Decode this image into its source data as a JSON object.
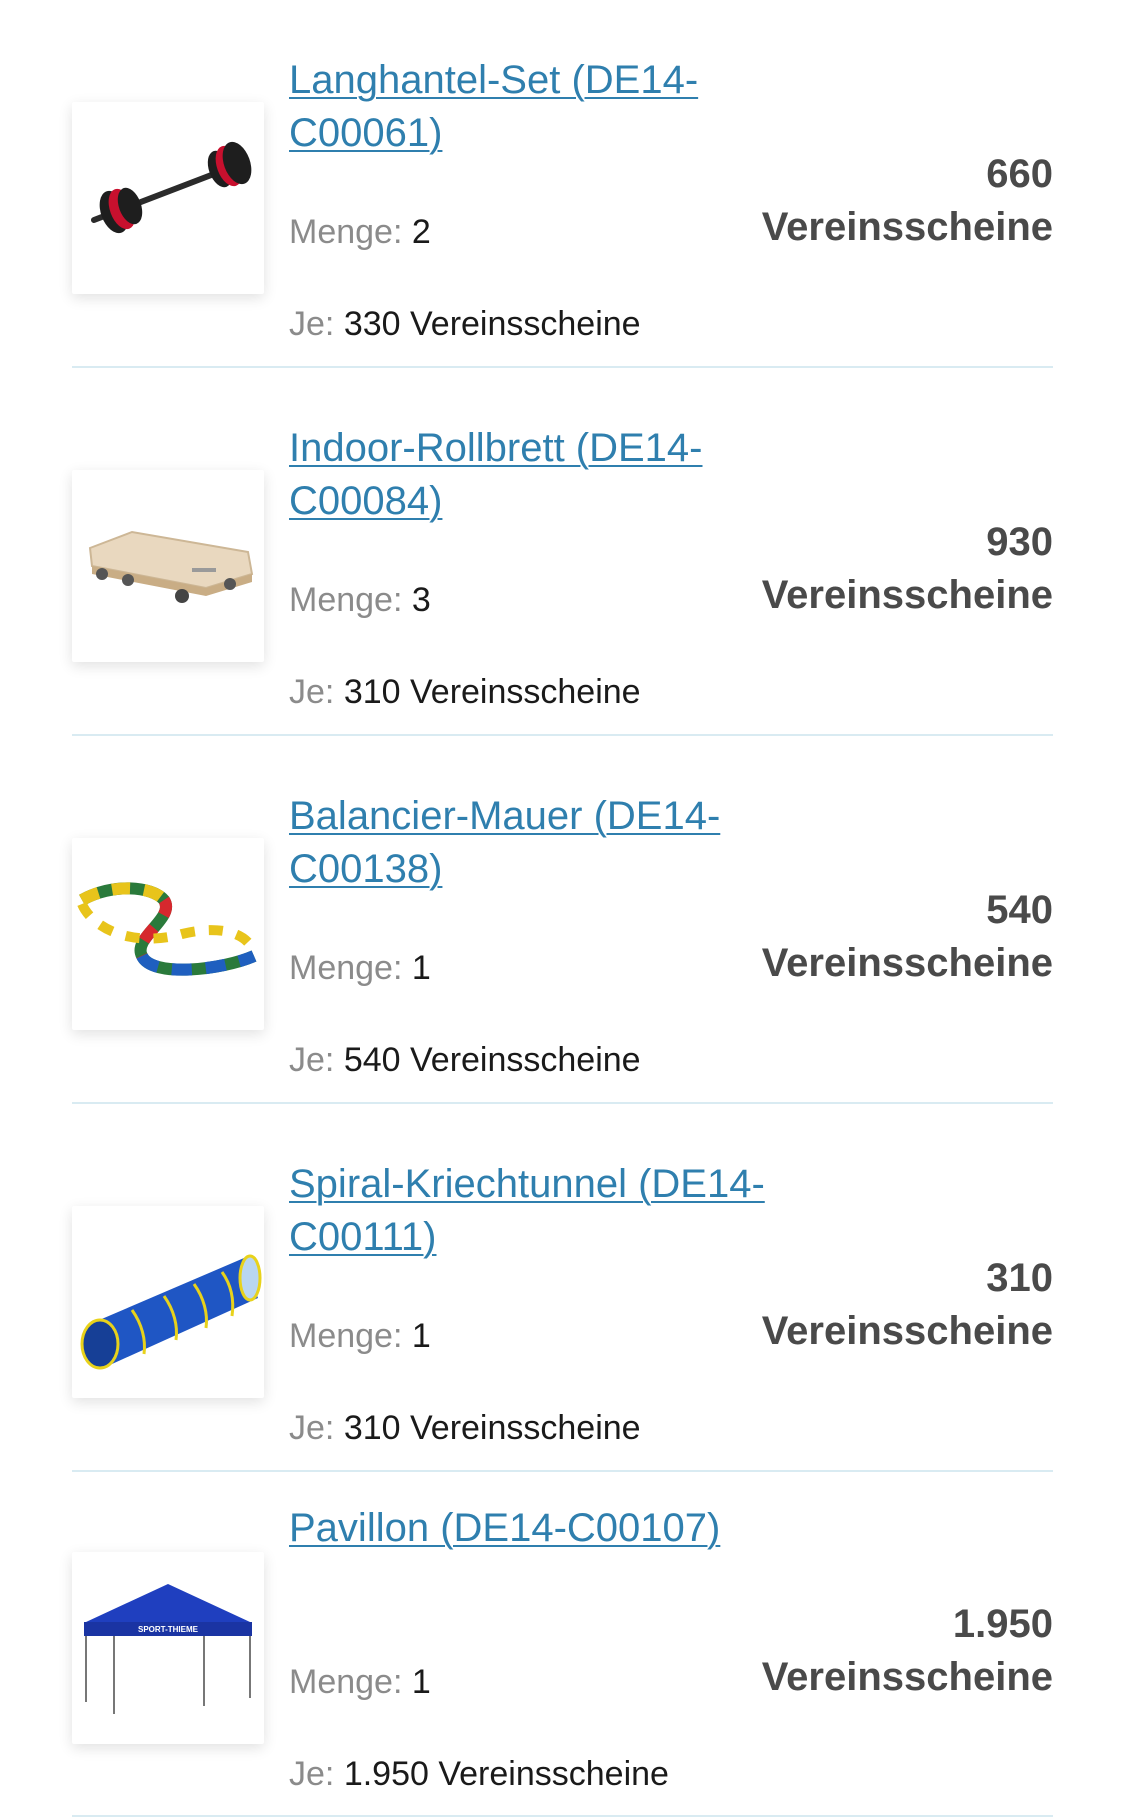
{
  "labels": {
    "quantity": "Menge:",
    "each": "Je:",
    "currency": "Vereinsscheine"
  },
  "items": [
    {
      "title": "Langhantel-Set (DE14-C00061)",
      "quantity": "2",
      "each_price": "330 Vereinsscheine",
      "total_amount": "660",
      "total_unit": "Vereinsscheine",
      "image": "barbell-set-image"
    },
    {
      "title": "Indoor-Rollbrett (DE14-C00084)",
      "quantity": "3",
      "each_price": "310 Vereinsscheine",
      "total_amount": "930",
      "total_unit": "Vereinsscheine",
      "image": "roller-board-image"
    },
    {
      "title": "Balancier-Mauer (DE14-C00138)",
      "quantity": "1",
      "each_price": "540 Vereinsscheine",
      "total_amount": "540",
      "total_unit": "Vereinsscheine",
      "image": "balance-wall-image"
    },
    {
      "title": "Spiral-Kriechtunnel (DE14-C00111)",
      "quantity": "1",
      "each_price": "310 Vereinsscheine",
      "total_amount": "310",
      "total_unit": "Vereinsscheine",
      "image": "crawl-tunnel-image"
    },
    {
      "title": "Pavillon (DE14-C00107)",
      "quantity": "1",
      "each_price": "1.950 Vereinsscheine",
      "total_amount": "1.950",
      "total_unit": "Vereinsscheine",
      "image": "pavilion-image",
      "image_text": "SPORT-THIEME"
    }
  ],
  "colors": {
    "link": "#2f7fae",
    "label": "#8b8b8b",
    "total": "#4a4a4a",
    "divider": "#d9ebf2"
  }
}
